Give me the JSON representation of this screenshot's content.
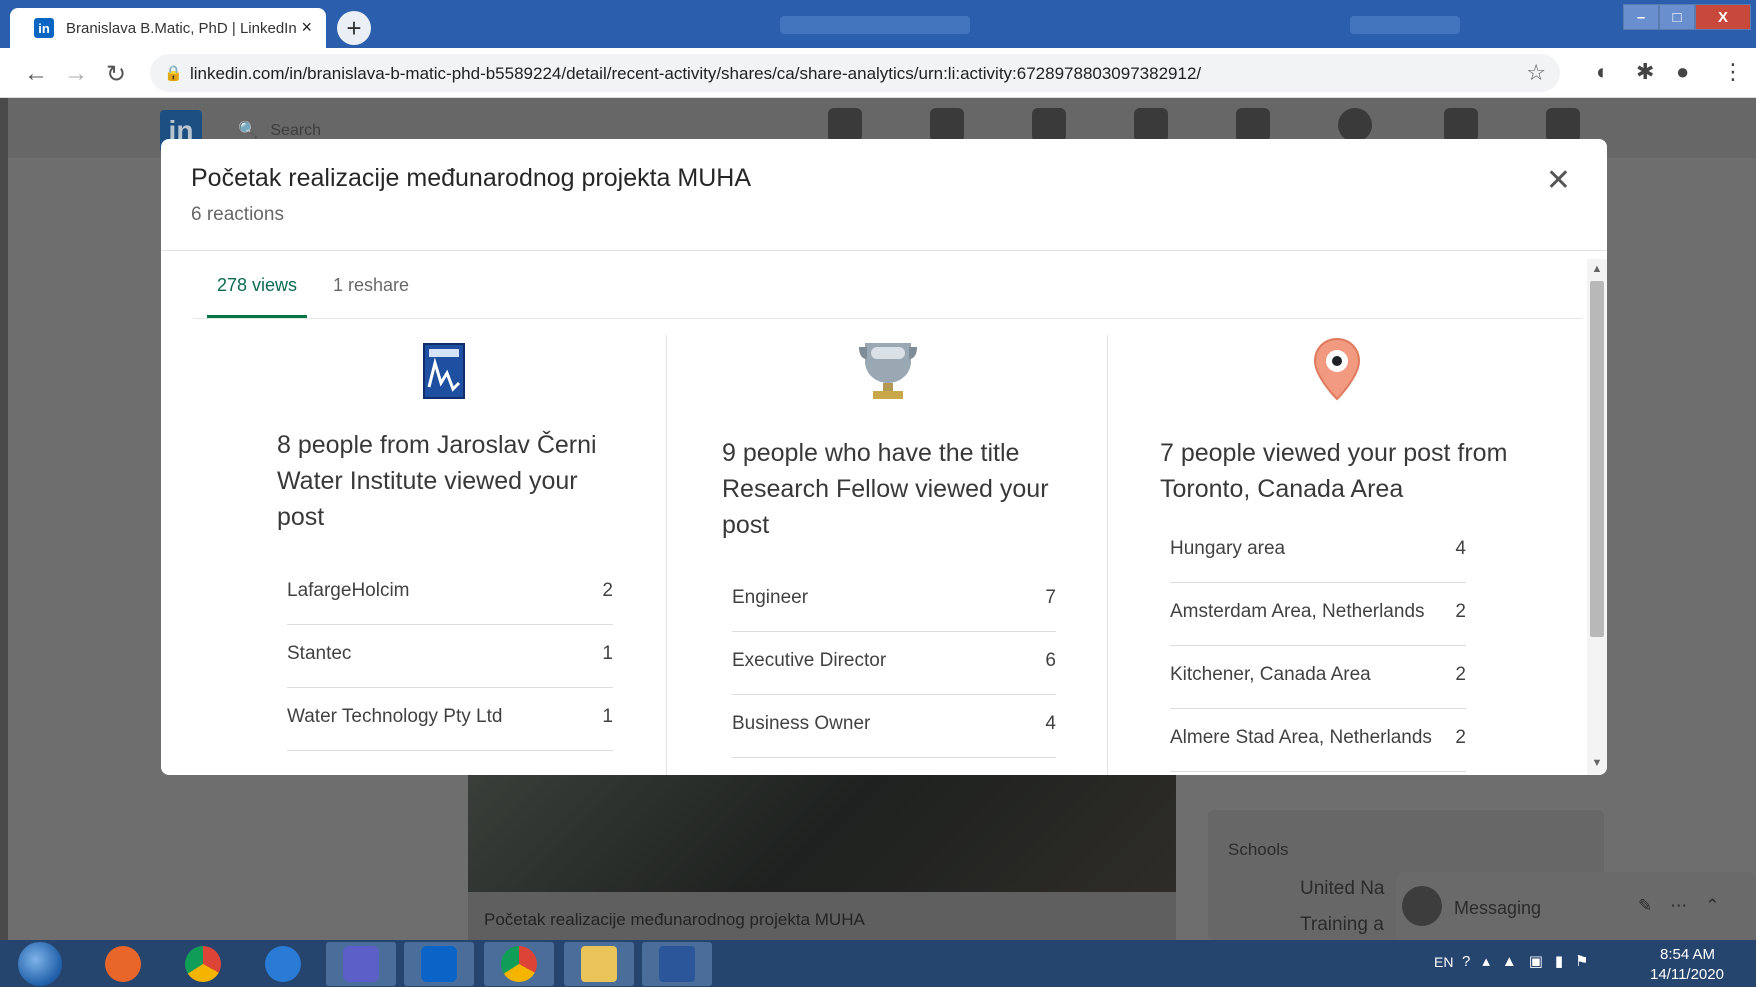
{
  "browser": {
    "tab_title": "Branislava B.Matic, PhD | LinkedIn",
    "tab_close": "×",
    "new_tab": "+",
    "url": "linkedin.com/in/branislava-b-matic-phd-b5589224/detail/recent-activity/shares/ca/share-analytics/urn:li:activity:6728978803097382912/",
    "window_controls": {
      "minimize": "–",
      "maximize": "□",
      "close": "X"
    }
  },
  "linkedin": {
    "logo": "in",
    "search_placeholder": "Search",
    "post_caption": "Početak realizacije međunarodnog projekta MUHA",
    "side": {
      "schools_label": "Schools",
      "line1": "United Na",
      "line2": "Training a"
    },
    "messaging_label": "Messaging"
  },
  "modal": {
    "title": "Početak realizacije međunarodnog projekta MUHA",
    "reactions": "6 reactions",
    "close_icon": "close-icon",
    "tabs": [
      {
        "label": "278 views",
        "active": true
      },
      {
        "label": "1 reshare",
        "active": false
      }
    ],
    "columns": [
      {
        "icon": "company-logo-icon",
        "headline": "8 people from Jaroslav Černi Water Institute viewed your post",
        "rows": [
          {
            "label": "LafargeHolcim",
            "count": "2"
          },
          {
            "label": "Stantec",
            "count": "1"
          },
          {
            "label": "Water Technology Pty Ltd",
            "count": "1"
          }
        ]
      },
      {
        "icon": "trophy-icon",
        "headline": "9 people who have the title Research Fellow viewed your post",
        "rows": [
          {
            "label": "Engineer",
            "count": "7"
          },
          {
            "label": "Executive Director",
            "count": "6"
          },
          {
            "label": "Business Owner",
            "count": "4"
          }
        ]
      },
      {
        "icon": "location-pin-icon",
        "headline": "7 people viewed your post from Toronto, Canada Area",
        "rows": [
          {
            "label": "Hungary area",
            "count": "4"
          },
          {
            "label": "Amsterdam Area, Netherlands",
            "count": "2"
          },
          {
            "label": "Kitchener, Canada Area",
            "count": "2"
          },
          {
            "label": "Almere Stad Area, Netherlands",
            "count": "2"
          }
        ]
      }
    ]
  },
  "taskbar": {
    "language": "EN",
    "time": "8:54 AM",
    "date": "14/11/2020"
  },
  "colors": {
    "active_tab": "#057642",
    "titlebar": "#2b5fae",
    "taskbar": "#26456e",
    "linkedin_blue": "#0a66c2"
  }
}
